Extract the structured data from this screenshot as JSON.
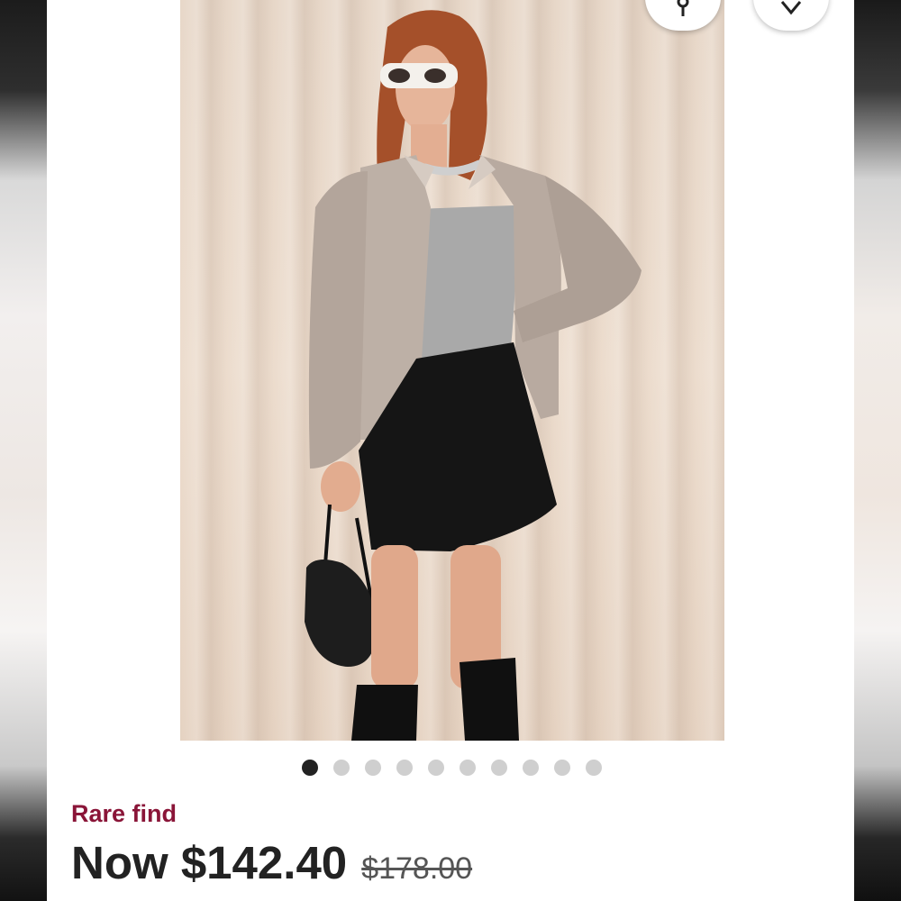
{
  "listing": {
    "badge": "Rare find",
    "price_now": "Now $142.40",
    "price_original": "$178.00"
  },
  "carousel": {
    "total_images": 10,
    "active_index": 0
  },
  "actions": {
    "share_icon": "share-icon",
    "favorite_icon": "heart-icon"
  },
  "colors": {
    "badge": "#8a1538",
    "dot_active": "#222222",
    "dot_inactive": "#cfcfcf"
  }
}
